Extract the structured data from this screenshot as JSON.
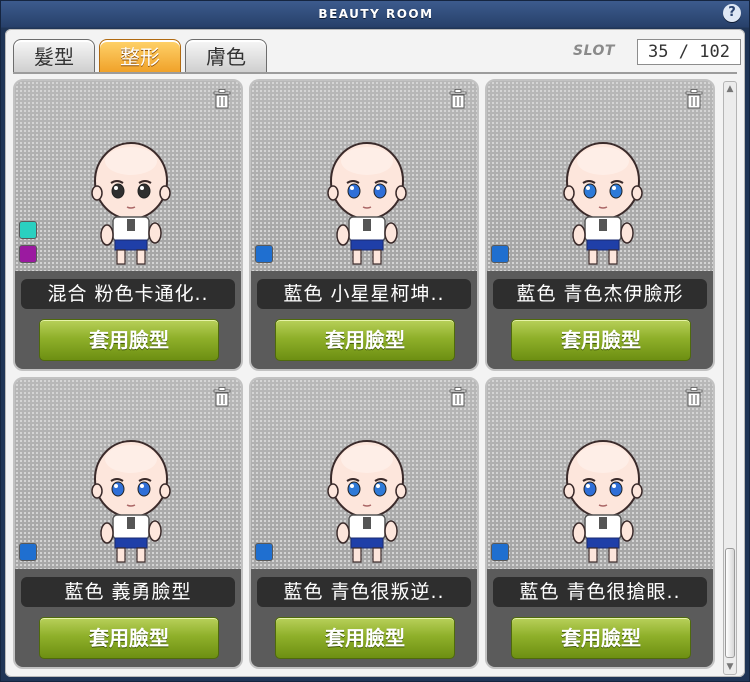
{
  "window": {
    "title": "BEAUTY ROOM",
    "help": "?"
  },
  "tabs": [
    {
      "label": "髮型",
      "active": false
    },
    {
      "label": "整形",
      "active": true
    },
    {
      "label": "膚色",
      "active": false
    }
  ],
  "slot": {
    "label": "SLOT",
    "value": "35 / 102"
  },
  "cards": [
    {
      "name": "混合 粉色卡通化..",
      "swatches": [
        "#2ad0c0",
        "#9b1aa0"
      ],
      "button": "套用臉型",
      "eyes": "#2f2f2f",
      "icon": "trash-icon"
    },
    {
      "name": "藍色 小星星柯坤..",
      "swatches": [
        "#1f6fd0"
      ],
      "button": "套用臉型",
      "eyes": "#2f6fd8",
      "icon": "trash-icon"
    },
    {
      "name": "藍色 青色杰伊臉形",
      "swatches": [
        "#1f6fd0"
      ],
      "button": "套用臉型",
      "eyes": "#2d7ad8",
      "icon": "trash-icon"
    },
    {
      "name": "藍色 義勇臉型",
      "swatches": [
        "#1f6fd0"
      ],
      "button": "套用臉型",
      "eyes": "#2f6fd8",
      "icon": "trash-icon"
    },
    {
      "name": "藍色 青色很叛逆..",
      "swatches": [
        "#1f6fd0"
      ],
      "button": "套用臉型",
      "eyes": "#2f7ad8",
      "icon": "trash-icon"
    },
    {
      "name": "藍色 青色很搶眼..",
      "swatches": [
        "#1f6fd0"
      ],
      "button": "套用臉型",
      "eyes": "#2f6fd8",
      "icon": "trash-icon"
    }
  ],
  "scrollbar": {
    "position": 0.86
  }
}
